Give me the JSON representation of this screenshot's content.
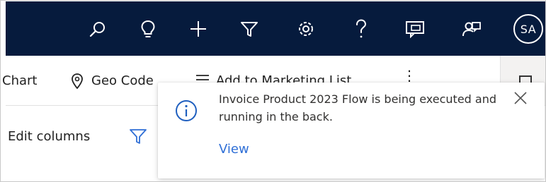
{
  "topbar": {
    "icons": [
      "search-icon",
      "lightbulb-icon",
      "add-icon",
      "filter-icon",
      "settings-icon",
      "help-icon",
      "chat-icon",
      "assist-icon"
    ],
    "avatar_initials": "SA",
    "background_color": "#061b3d"
  },
  "command_bar": {
    "chart_label": "Chart",
    "geo_code_label": "Geo Code",
    "marketing_label": "Add to Marketing List",
    "more_label": "⋮"
  },
  "grid_toolbar": {
    "edit_columns_label": "Edit columns"
  },
  "toast": {
    "message": "Invoice Product 2023 Flow is being executed and running in the back.",
    "action_label": "View",
    "accent_color": "#2f6fd6"
  }
}
